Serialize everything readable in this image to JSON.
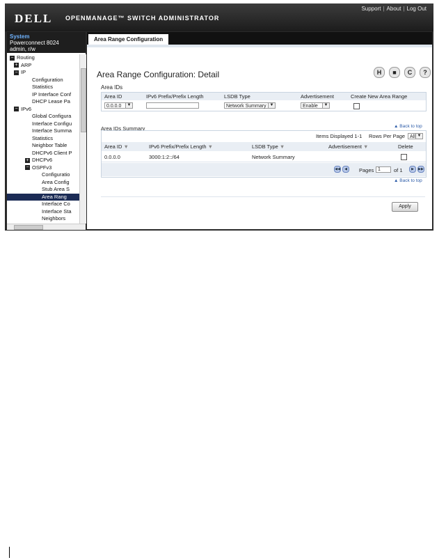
{
  "header": {
    "logo": "DELL",
    "app_title": "OPENMANAGE™ SWITCH ADMINISTRATOR",
    "links": [
      "Support",
      "About",
      "Log Out"
    ]
  },
  "sidebar": {
    "system_label": "System",
    "device": "Powerconnect 8024",
    "user": "admin, r/w",
    "tree": [
      {
        "label": "Routing",
        "expander": "minus"
      },
      {
        "label": "ARP",
        "expander": "plus"
      },
      {
        "label": "IP",
        "expander": "minus"
      },
      {
        "label": "Configuration"
      },
      {
        "label": "Statistics"
      },
      {
        "label": "IP Interface Conf"
      },
      {
        "label": "DHCP Lease Pa"
      },
      {
        "label": "IPv6",
        "expander": "minus"
      },
      {
        "label": "Global Configura"
      },
      {
        "label": "Interface Configu"
      },
      {
        "label": "Interface Summa"
      },
      {
        "label": "Statistics"
      },
      {
        "label": "Neighbor Table"
      },
      {
        "label": "DHCPv6 Client P"
      },
      {
        "label": "DHCPv6",
        "expander": "plus"
      },
      {
        "label": "OSPFv3",
        "expander": "minus"
      },
      {
        "label": "Configuratio"
      },
      {
        "label": "Area Config"
      },
      {
        "label": "Stub Area S"
      },
      {
        "label": "Area Rang",
        "selected": true
      },
      {
        "label": "Interface Co"
      },
      {
        "label": "Interface Sta"
      },
      {
        "label": "Neighbors"
      }
    ]
  },
  "main": {
    "tab": "Area Range Configuration",
    "title": "Area Range Configuration: Detail",
    "icons": [
      "save-icon",
      "print-icon",
      "refresh-icon",
      "help-icon"
    ],
    "icon_glyphs": [
      "H",
      "■",
      "C",
      "?"
    ],
    "area_ids": {
      "section": "Area IDs",
      "headers": [
        "Area ID",
        "IPv6 Prefix/Prefix Length",
        "LSDB Type",
        "Advertisement",
        "Create New Area Range"
      ],
      "area_id_value": "0.0.0.0",
      "prefix_value": "",
      "lsdb_value": "Network Summary",
      "advertisement_value": "Enable"
    },
    "back_to_top": "Back to top",
    "summary": {
      "section": "Area IDs Summary",
      "items_displayed": "Items Displayed 1-1",
      "rows_per_page_label": "Rows Per Page",
      "rows_per_page_value": "All",
      "headers": [
        "Area ID",
        "IPv6 Prefix/Prefix Length",
        "LSDB Type",
        "Advertisement",
        "Delete"
      ],
      "rows": [
        {
          "area_id": "0.0.0.0",
          "prefix": "3000:1:2::/64",
          "lsdb": "Network Summary",
          "advertisement": ""
        }
      ],
      "pages_label": "Pages",
      "page_value": "1",
      "of_label": "of 1"
    },
    "apply": "Apply"
  }
}
